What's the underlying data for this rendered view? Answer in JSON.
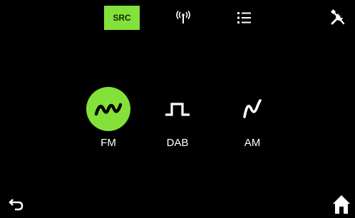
{
  "topbar": {
    "tabs": [
      {
        "id": "src",
        "label": "SRC",
        "icon": null,
        "active": true
      },
      {
        "id": "antenna",
        "label": "",
        "icon": "antenna-signal-icon",
        "active": false
      },
      {
        "id": "list",
        "label": "",
        "icon": "list-icon",
        "active": false
      }
    ],
    "settings_icon": "tools-icon"
  },
  "sources": [
    {
      "id": "fm",
      "label": "FM",
      "icon": "fm-wave-icon",
      "active": true
    },
    {
      "id": "dab",
      "label": "DAB",
      "icon": "dab-square-wave-icon",
      "active": false
    },
    {
      "id": "am",
      "label": "AM",
      "icon": "am-wave-icon",
      "active": false
    }
  ],
  "footer": {
    "back_icon": "back-arrow-icon",
    "home_icon": "home-icon"
  },
  "colors": {
    "accent": "#84e13a",
    "background": "#000000",
    "text": "#ffffff"
  }
}
